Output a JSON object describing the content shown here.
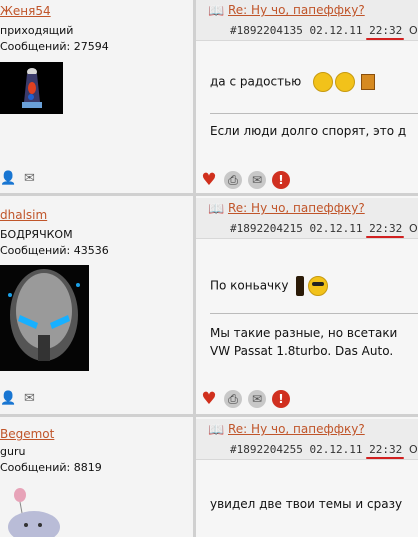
{
  "posts": [
    {
      "username": "Женя54",
      "rank": "приходящий",
      "messages": "Сообщений: 27594",
      "title": "Re: Ну чо, папеффку?",
      "meta": "#1892204135 02.12.11 22:32",
      "meta_cut": "О",
      "text": "да с радостью",
      "signature": "Если люди долго спорят, это д",
      "avatar_icon": "lava-lamp"
    },
    {
      "username": "dhalsim",
      "rank": "БОДРЯЧКОМ",
      "messages": "Сообщений: 43536",
      "title": "Re: Ну чо, папеффку?",
      "meta": "#1892204215 02.12.11 22:32",
      "meta_cut": "О",
      "text": "По коньачку",
      "signature": "Мы такие разные, но всетаки",
      "signature2": "VW Passat 1.8turbo. Das Auto.",
      "avatar_icon": "robot-face"
    },
    {
      "username": "Begemot",
      "rank": "guru",
      "messages": "Сообщений: 8819",
      "title": "Re: Ну чо, папеффку?",
      "meta": "#1892204255 02.12.11 22:32",
      "meta_cut": "О",
      "text": "увидел две твои темы и сразу",
      "avatar_icon": "hippo"
    }
  ],
  "icons": {
    "user_add": "add-user-icon",
    "mail": "mail-icon",
    "like": "heart-icon",
    "print": "printer-icon",
    "envelope": "envelope-icon",
    "report": "warning-icon"
  }
}
